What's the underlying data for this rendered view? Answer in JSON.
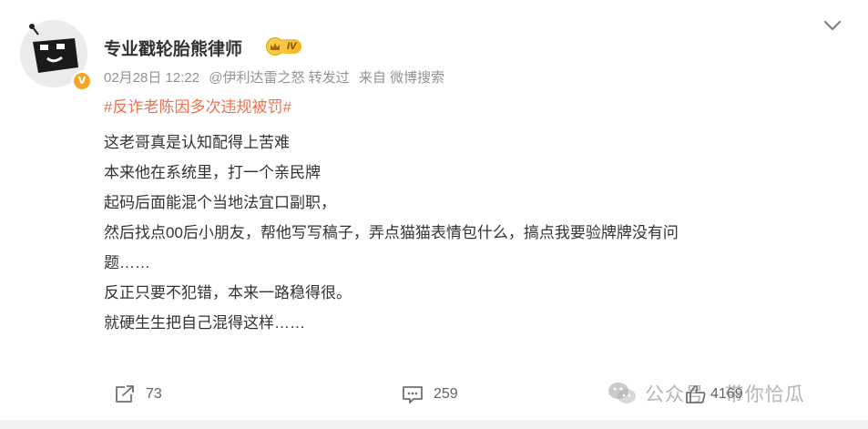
{
  "post": {
    "username": "专业戳轮胎熊律师",
    "level_badge": "IV",
    "verified_mark": "V",
    "meta": {
      "date": "02月28日 12:22",
      "repost_from": "@伊利达雷之怒 转发过",
      "source": "来自 微博搜索"
    },
    "topic": "#反诈老陈因多次违规被罚#",
    "lines": [
      "这老哥真是认知配得上苦难",
      "本来他在系统里，打一个亲民牌",
      "起码后面能混个当地法宜口副职，",
      "然后找点00后小朋友，帮他写写稿子，弄点猫猫表情包什么，搞点我要验牌牌没有问",
      "题……",
      "反正只要不犯错，本来一路稳得很。",
      "就硬生生把自己混得这样……"
    ]
  },
  "actions": {
    "repost_count": "73",
    "comment_count": "259",
    "like_count": "4169"
  },
  "watermark": "公众号 · 带你恰瓜",
  "colors": {
    "topic": "#eb7350",
    "meta": "#939393",
    "text": "#333333",
    "badge_gold": "#f7c948",
    "verified": "#f5a623"
  },
  "icons": {
    "more": "chevron-down-icon",
    "repost": "repost-icon",
    "comment": "comment-icon",
    "like": "thumbs-up-icon",
    "watermark": "wechat-icon"
  }
}
